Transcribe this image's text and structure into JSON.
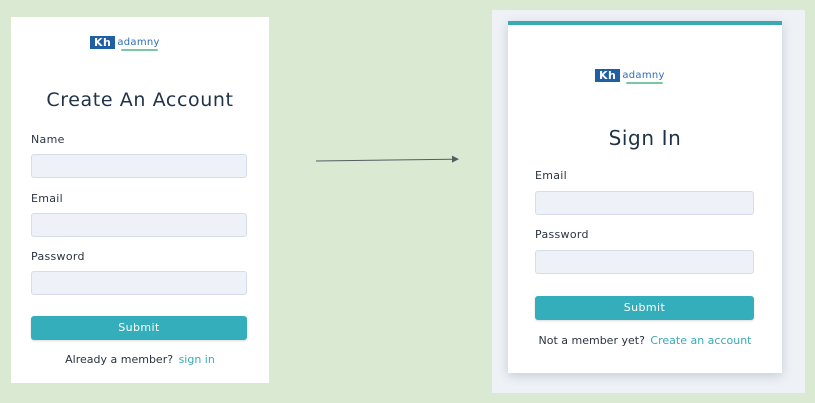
{
  "brand": {
    "logo_box_text": "Kh",
    "logo_text": "adamny"
  },
  "register": {
    "title": "Create An Account",
    "name_label": "Name",
    "email_label": "Email",
    "password_label": "Password",
    "submit_label": "Submit",
    "footer_text": "Already a member?",
    "footer_link": "sign in"
  },
  "signin": {
    "title": "Sign In",
    "email_label": "Email",
    "password_label": "Password",
    "submit_label": "Submit",
    "footer_text": "Not a member yet?",
    "footer_link": "Create an account"
  },
  "colors": {
    "background": "#d9e9d2",
    "accent": "#34aeba",
    "logo_blue": "#1f5fa4",
    "field_bg": "#eef2f8"
  },
  "icons": {
    "flow_arrow": "right-arrow-icon"
  }
}
